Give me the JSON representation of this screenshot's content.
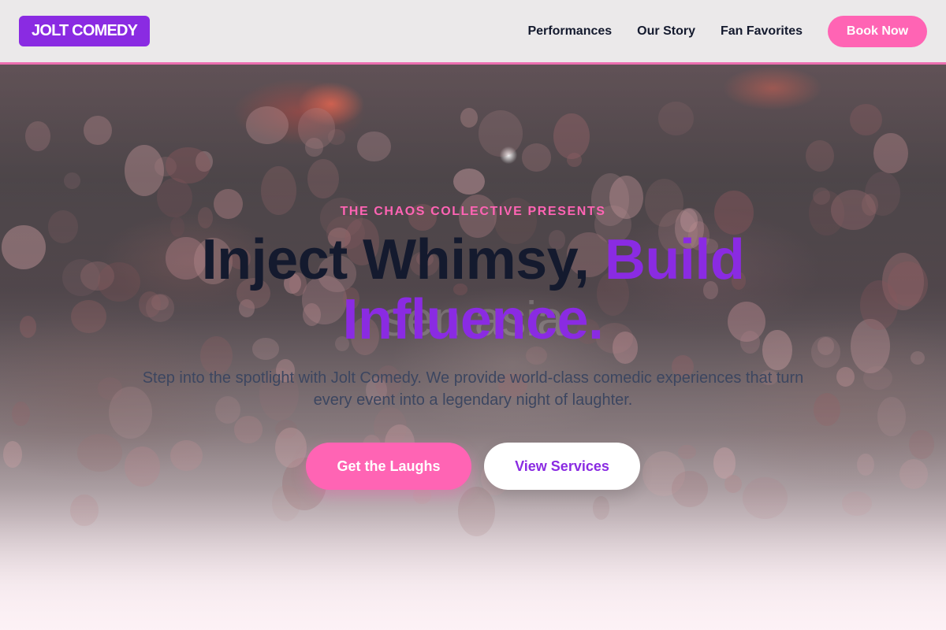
{
  "header": {
    "logo": "JOLT COMEDY",
    "nav": [
      "Performances",
      "Our Story",
      "Fan Favorites"
    ],
    "cta": "Book Now"
  },
  "hero": {
    "eyebrow": "THE CHAOS COLLECTIVE PRESENTS",
    "headline_main": "Inject Whimsy, ",
    "headline_accent": "Build Influence.",
    "watermark": "sen            asia",
    "subtext": "Step into the spotlight with Jolt Comedy. We provide world-class comedic experiences that turn every event into a legendary night of laughter.",
    "primary_cta": "Get the Laughs",
    "secondary_cta": "View Services"
  },
  "colors": {
    "brand_purple": "#8a2be2",
    "brand_pink": "#ff64b4",
    "dark_text": "#141a2e"
  }
}
